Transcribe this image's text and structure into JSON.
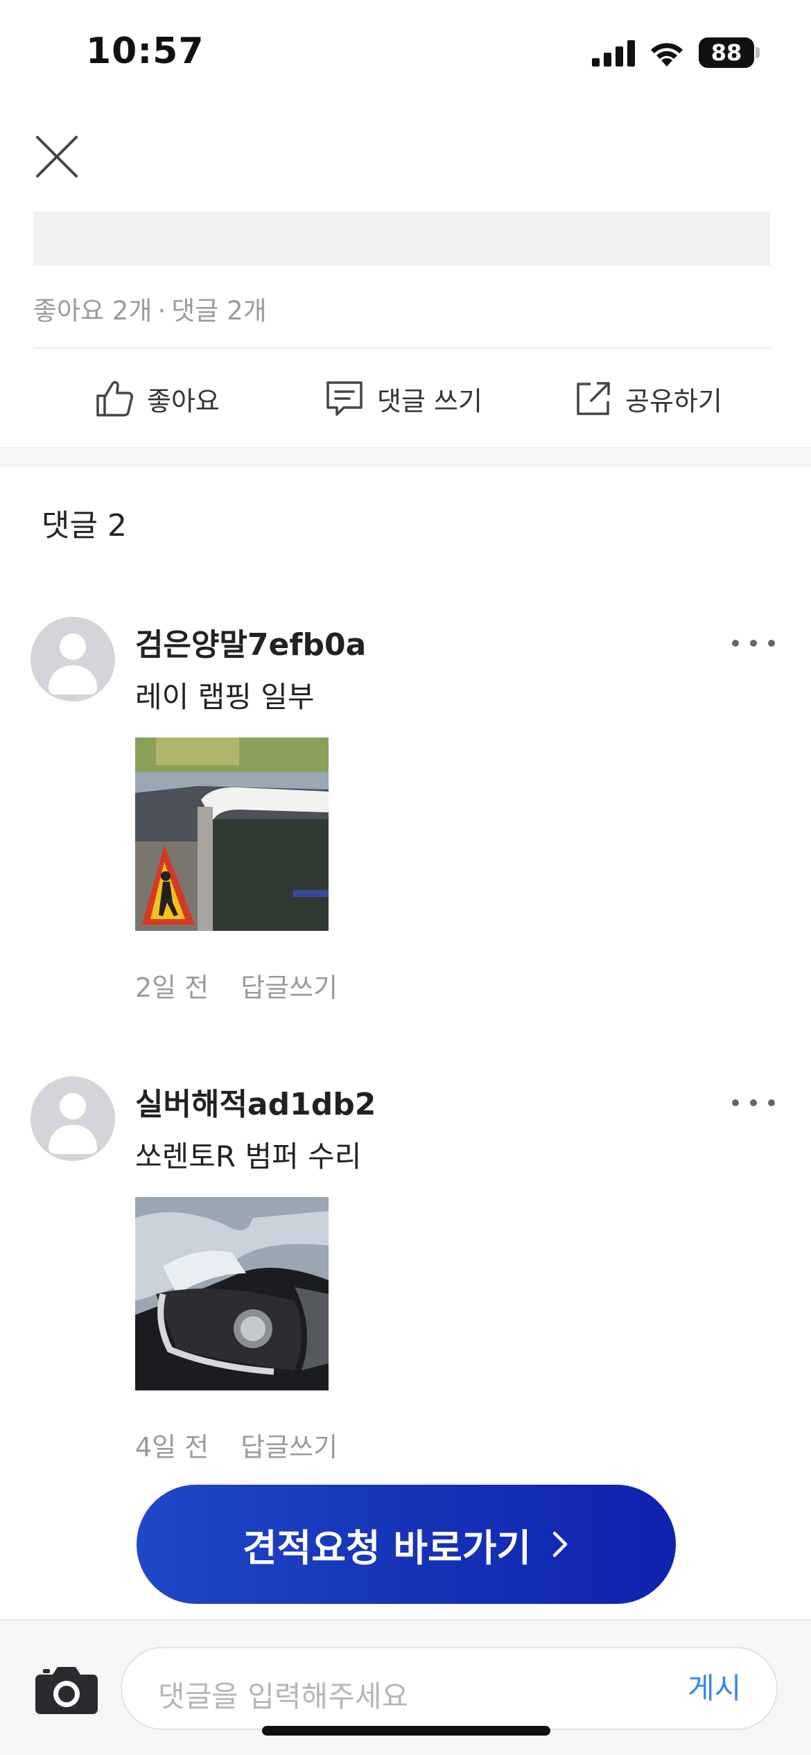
{
  "status_bar": {
    "time": "10:57",
    "battery": "88"
  },
  "post": {
    "meta": {
      "likes": "좋아요 2개",
      "separator": "·",
      "comments": "댓글 2개"
    },
    "actions": {
      "like": "좋아요",
      "comment": "댓글 쓰기",
      "share": "공유하기"
    }
  },
  "comments_section": {
    "header": "댓글 2",
    "items": [
      {
        "username": "검은양말7efb0a",
        "text": "레이 랩핑 일부",
        "time": "2일 전",
        "reply": "답글쓰기",
        "image": "car-window-wrapping-photo"
      },
      {
        "username": "실버해적ad1db2",
        "text": "쏘렌토R 범퍼 수리",
        "time": "4일 전",
        "reply": "답글쓰기",
        "image": "car-bumper-damage-photo"
      }
    ]
  },
  "cta": {
    "label": "견적요청 바로가기"
  },
  "composer": {
    "placeholder": "댓글을 입력해주세요",
    "post_label": "게시"
  },
  "colors": {
    "cta_start": "#1f48c8",
    "cta_end": "#0e22b0",
    "post_link": "#3b82f0",
    "muted_text": "#9a9a9a"
  },
  "icons": [
    "close-icon",
    "thumbs-up-icon",
    "comment-icon",
    "share-icon",
    "more-icon",
    "camera-icon",
    "chevron-right-icon",
    "signal-icon",
    "wifi-icon",
    "battery-icon"
  ]
}
